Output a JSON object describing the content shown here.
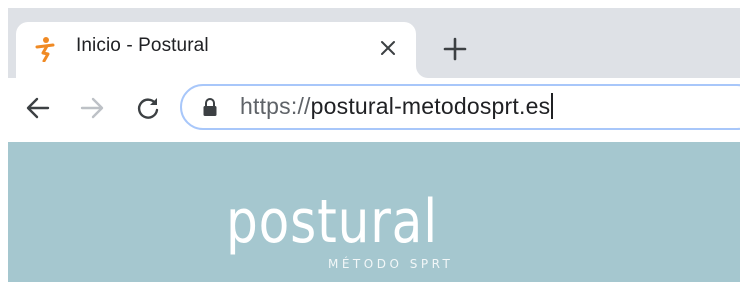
{
  "browser": {
    "tab": {
      "title": "Inicio - Postural",
      "favicon": "postural-figure-icon",
      "favicon_color": "#f08a24",
      "close_icon": "close-icon"
    },
    "new_tab_icon": "plus-icon",
    "toolbar": {
      "back_icon": "arrow-left-icon",
      "forward_icon": "arrow-right-icon",
      "reload_icon": "reload-icon"
    },
    "address_bar": {
      "lock_icon": "lock-icon",
      "scheme": "https://",
      "host": "postural-metodosprt.es",
      "focus_color": "#a8c7fa"
    }
  },
  "page": {
    "background_color": "#a5c7cf",
    "logo": {
      "wordmark": "postural",
      "tagline": "MÉTODO SPRT"
    }
  }
}
